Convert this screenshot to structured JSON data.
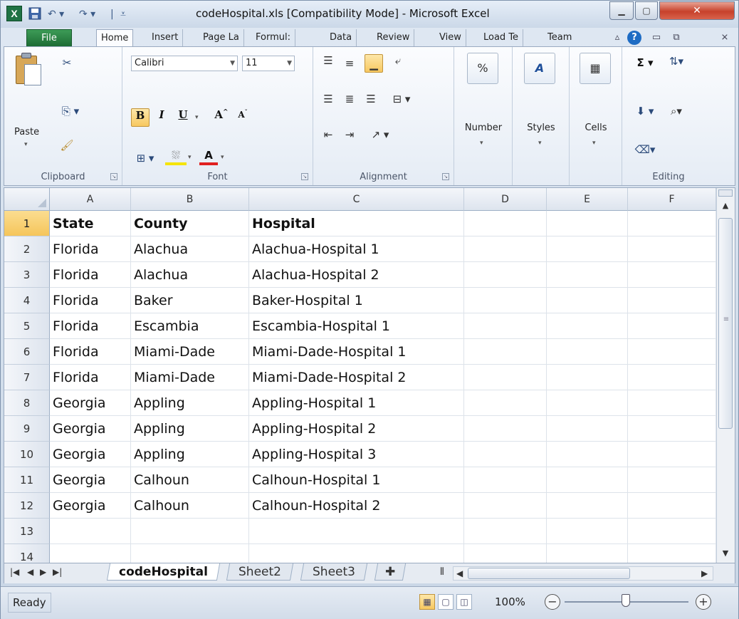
{
  "window": {
    "title": "codeHospital.xls  [Compatibility Mode]  -  Microsoft Excel",
    "app_icon": "X"
  },
  "ribbon_tabs": [
    "File",
    "Home",
    "Insert",
    "Page La",
    "Formul:",
    "Data",
    "Review",
    "View",
    "Load Te",
    "Team"
  ],
  "ribbon": {
    "clipboard": {
      "label": "Clipboard",
      "paste": "Paste"
    },
    "font": {
      "label": "Font",
      "name": "Calibri",
      "size": "11"
    },
    "alignment": {
      "label": "Alignment"
    },
    "number": {
      "label": "Number",
      "icon_text": "%"
    },
    "styles": {
      "label": "Styles"
    },
    "cells": {
      "label": "Cells"
    },
    "editing": {
      "label": "Editing"
    }
  },
  "columns": [
    "A",
    "B",
    "C",
    "D",
    "E",
    "F"
  ],
  "rows": [
    {
      "num": "1",
      "cells": [
        "State",
        "County",
        "Hospital"
      ]
    },
    {
      "num": "2",
      "cells": [
        "Florida",
        "Alachua",
        "Alachua-Hospital 1"
      ]
    },
    {
      "num": "3",
      "cells": [
        "Florida",
        "Alachua",
        "Alachua-Hospital 2"
      ]
    },
    {
      "num": "4",
      "cells": [
        "Florida",
        "Baker",
        "Baker-Hospital 1"
      ]
    },
    {
      "num": "5",
      "cells": [
        "Florida",
        "Escambia",
        "Escambia-Hospital 1"
      ]
    },
    {
      "num": "6",
      "cells": [
        "Florida",
        "Miami-Dade",
        "Miami-Dade-Hospital 1"
      ]
    },
    {
      "num": "7",
      "cells": [
        "Florida",
        "Miami-Dade",
        "Miami-Dade-Hospital 2"
      ]
    },
    {
      "num": "8",
      "cells": [
        "Georgia",
        "Appling",
        "Appling-Hospital 1"
      ]
    },
    {
      "num": "9",
      "cells": [
        "Georgia",
        "Appling",
        "Appling-Hospital 2"
      ]
    },
    {
      "num": "10",
      "cells": [
        "Georgia",
        "Appling",
        "Appling-Hospital 3"
      ]
    },
    {
      "num": "11",
      "cells": [
        "Georgia",
        "Calhoun",
        "Calhoun-Hospital 1"
      ]
    },
    {
      "num": "12",
      "cells": [
        "Georgia",
        "Calhoun",
        "Calhoun-Hospital 2"
      ]
    },
    {
      "num": "13",
      "cells": [
        "",
        "",
        ""
      ]
    },
    {
      "num": "14",
      "cells": [
        "",
        "",
        ""
      ]
    }
  ],
  "sheet_tabs": [
    "codeHospital",
    "Sheet2",
    "Sheet3"
  ],
  "active_sheet": "codeHospital",
  "status": {
    "mode": "Ready",
    "zoom": "100%"
  }
}
